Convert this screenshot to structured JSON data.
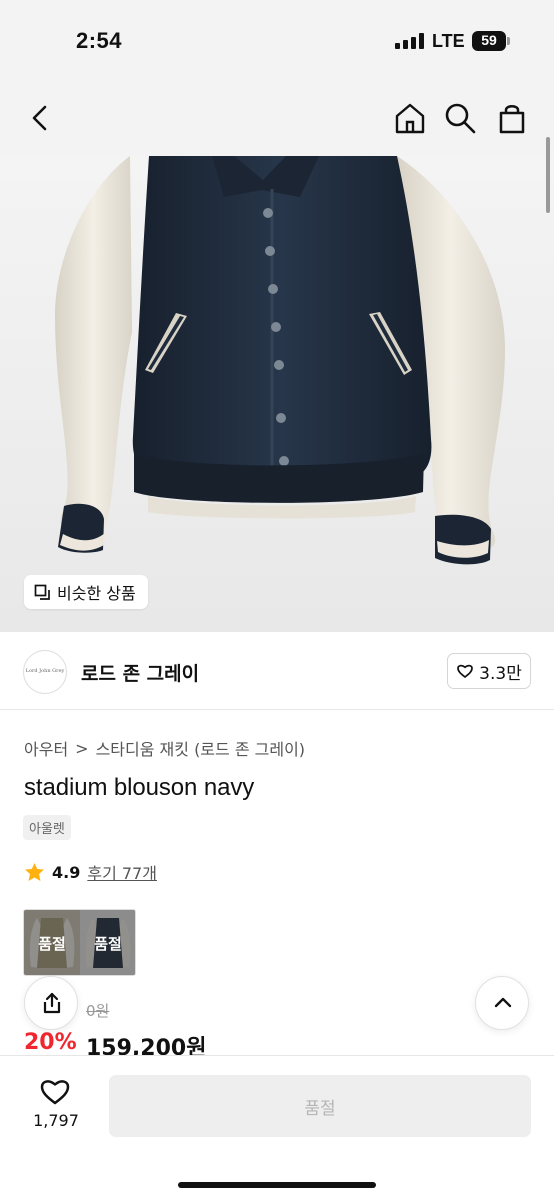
{
  "status": {
    "time": "2:54",
    "network": "LTE",
    "battery": "59"
  },
  "icons": {
    "back": "chevron-left",
    "home": "home",
    "search": "magnifier",
    "bag": "shopping-bag",
    "similar": "copy",
    "like": "heart",
    "rating": "star",
    "share": "share",
    "top": "chevron-up"
  },
  "hero": {
    "similar_button": "비슷한 상품",
    "background": "#f2f2f2"
  },
  "brand": {
    "logo_text": "Lord John Grey",
    "name": "로드 존 그레이",
    "like_count": "3.3만"
  },
  "product": {
    "breadcrumb": [
      "아우터",
      ">",
      "스타디움 재킷 (로드 존 그레이)"
    ],
    "title": "stadium blouson navy",
    "tag": "아울렛",
    "rating": "4.9",
    "review_link": "후기 77개",
    "variants": [
      {
        "status": "품절"
      },
      {
        "status": "품절"
      }
    ],
    "original_price_visible": "0원",
    "discount": "20%",
    "sale_price": "159,200원"
  },
  "bottom_bar": {
    "wish_count": "1,797",
    "purchase_button": "품절"
  },
  "colors": {
    "accent_red": "#f1272f",
    "navy": "#1e2b3d",
    "cream": "#eee9df",
    "text": "#111111"
  }
}
